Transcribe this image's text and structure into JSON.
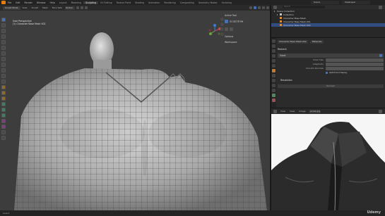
{
  "app": {
    "menus": [
      "File",
      "Edit",
      "Render",
      "Window",
      "Help"
    ],
    "workspaces": [
      "Layout",
      "Modeling",
      "Sculpting",
      "UV Editing",
      "Texture Paint",
      "Shading",
      "Animation",
      "Rendering",
      "Compositing",
      "Geometry Nodes",
      "Scripting"
    ],
    "active_workspace": "Sculpting",
    "scene": "Scene",
    "view_layer": "ViewLayer"
  },
  "viewport_header": {
    "mode": "Sculpt Mode",
    "items": [
      "View",
      "Sculpt",
      "Mask",
      "Face Sets"
    ],
    "dropdown": "Global"
  },
  "viewport": {
    "info_line1": "User Perspective",
    "info_line2": "(1) Character Base Mesh 002"
  },
  "npanel": {
    "active_tool": "Active Tool",
    "tool_name": "Sculpt Draw",
    "options": "Options",
    "workspace": "Workspace"
  },
  "outliner": {
    "search_placeholder": "Search",
    "rows": [
      {
        "label": "Scene Collection",
        "selected": false
      },
      {
        "label": "Collection",
        "selected": false
      },
      {
        "label": "Character Base Mesh",
        "selected": false
      },
      {
        "label": "Character Base Mesh.001",
        "selected": false
      },
      {
        "label": "Character Base Mesh.002",
        "selected": true
      }
    ]
  },
  "properties": {
    "object_name": "Character Base Mesh.002",
    "data_name": "Materials",
    "section": "Remesh",
    "remesh_mode": "Voxel",
    "rows": [
      {
        "label": "Voxel Size",
        "value": ""
      },
      {
        "label": "Adaptivity",
        "value": ""
      },
      {
        "label": "Smooth Normals",
        "value": ""
      }
    ],
    "checkbox_label": "Optimize Display",
    "subsection": "Resolution",
    "button": "Remesh"
  },
  "image_editor": {
    "items": [
      "View",
      "View",
      "Image"
    ],
    "image_name": "jacket.jpg"
  },
  "status": {
    "left": "Select",
    "watermark": "Udemy"
  },
  "colors": {
    "viewport_bg": "#3d3d3d",
    "selection": "#334d80",
    "accent": "#4772b3"
  }
}
